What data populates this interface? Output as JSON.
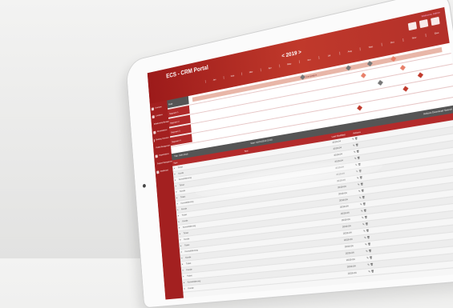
{
  "header": {
    "title": "ECS - CRM Portal",
    "welcome": "Welcome, Admin",
    "year_label": "< 2019 >",
    "months": [
      "Jan",
      "Feb",
      "Mar",
      "Apr",
      "May",
      "Jun",
      "Jul",
      "Aug",
      "Sep",
      "Oct",
      "Nov",
      "Dec"
    ]
  },
  "sidebar": {
    "items": [
      {
        "label": "Overview"
      },
      {
        "label": "Locations"
      },
      {
        "label": "Relationship Manager"
      },
      {
        "label": "Administration"
      },
      {
        "label": "Booking Overview"
      },
      {
        "label": "Profile Management"
      },
      {
        "label": "Organizations"
      },
      {
        "label": "Support Management"
      },
      {
        "label": "Dashboard"
      }
    ]
  },
  "gantt": {
    "bar_label": "Muli-Campaigns",
    "rows": [
      {
        "name": "Multi"
      },
      {
        "name": "Segment 1"
      },
      {
        "name": "Segment 2"
      },
      {
        "name": "Segment 3"
      },
      {
        "name": "Segment 4"
      }
    ]
  },
  "toolbar": {
    "left": "Title: CRM 2019",
    "mid": "Start: 01/01/2019  15:00",
    "right": "Actions    Download  Search"
  },
  "table": {
    "headers": [
      "Type",
      "Text",
      "Last Modified",
      "Actions"
    ],
    "rows": [
      {
        "type": "▸",
        "text": "Ticket",
        "date": "2019-04",
        "act": "✎ 🗑"
      },
      {
        "type": "▸",
        "text": "Kunde",
        "date": "2019-04",
        "act": "✎ 🗑"
      },
      {
        "type": "▸",
        "text": "Konsolidierung",
        "date": "2019-04",
        "act": "✎ 🗑"
      },
      {
        "type": "▸",
        "text": "Ticket",
        "date": "2019-04",
        "act": "✎ 🗑"
      },
      {
        "type": "▸",
        "text": "Kunde",
        "date": "2019-04",
        "act": "✎ 🗑"
      },
      {
        "type": "▸",
        "text": "Ticket",
        "date": "2019-04",
        "act": "✎ 🗑"
      },
      {
        "type": "▸",
        "text": "Konsolidierung",
        "date": "2019-04",
        "act": "✎ 🗑"
      },
      {
        "type": "▸",
        "text": "Kunde",
        "date": "2019-04",
        "act": "✎ 🗑"
      },
      {
        "type": "▸",
        "text": "Ticket",
        "date": "2019-04",
        "act": "✎ 🗑"
      },
      {
        "type": "▸",
        "text": "Kunde",
        "date": "2019-04",
        "act": "✎ 🗑"
      },
      {
        "type": "▸",
        "text": "Konsolidierung",
        "date": "2019-04",
        "act": "✎ 🗑"
      },
      {
        "type": "▸",
        "text": "Ticket",
        "date": "2019-04",
        "act": "✎ 🗑"
      },
      {
        "type": "▸",
        "text": "Kunde",
        "date": "2019-04",
        "act": "✎ 🗑"
      },
      {
        "type": "▸",
        "text": "Ticket",
        "date": "2019-04",
        "act": "✎ 🗑"
      },
      {
        "type": "▸",
        "text": "Konsolidierung",
        "date": "2019-04",
        "act": "✎ 🗑"
      },
      {
        "type": "▸",
        "text": "Kunde",
        "date": "2019-04",
        "act": "✎ 🗑"
      },
      {
        "type": "▸",
        "text": "Ticket",
        "date": "2019-04",
        "act": "✎ 🗑"
      },
      {
        "type": "▸",
        "text": "Kunde",
        "date": "2019-04",
        "act": "✎ 🗑"
      },
      {
        "type": "▸",
        "text": "Ticket",
        "date": "2019-04",
        "act": "✎ 🗑"
      },
      {
        "type": "▸",
        "text": "Konsolidierung",
        "date": "2019-04",
        "act": "✎ 🗑"
      },
      {
        "type": "▸",
        "text": "Kunde",
        "date": "2019-04",
        "act": "✎ 🗑"
      }
    ]
  },
  "colors": {
    "brand": "#b32b2b",
    "brand_dark": "#9c1a1a",
    "milestone_red": "#c0392b",
    "milestone_grey": "#777777",
    "milestone_salmon": "#e8806a"
  }
}
